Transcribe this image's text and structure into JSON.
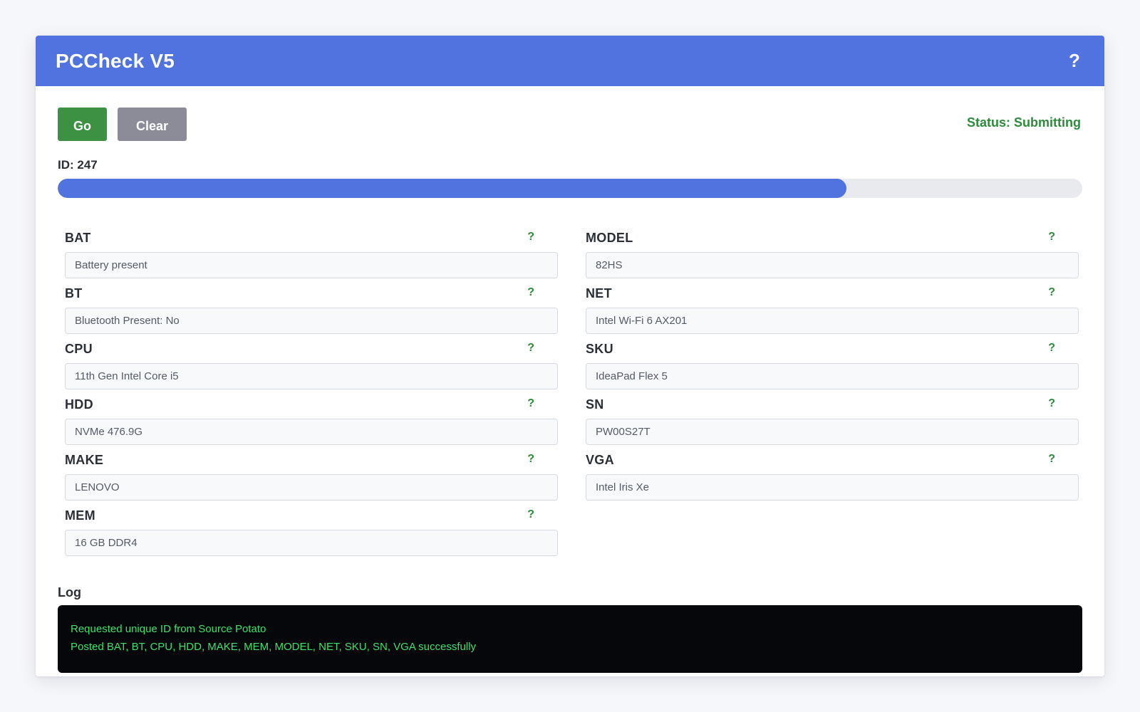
{
  "app": {
    "title": "PCCheck V5",
    "help_label": "?"
  },
  "toolbar": {
    "go_label": "Go",
    "clear_label": "Clear",
    "status": "Status: Submitting"
  },
  "job": {
    "id_label": "ID: 247",
    "progress_percent": 77
  },
  "fields": {
    "left": [
      {
        "key": "BAT",
        "label": "BAT",
        "value": "Battery present",
        "help": "?"
      },
      {
        "key": "BT",
        "label": "BT",
        "value": "Bluetooth Present: No",
        "help": "?"
      },
      {
        "key": "CPU",
        "label": "CPU",
        "value": "11th Gen Intel Core i5",
        "help": "?"
      },
      {
        "key": "HDD",
        "label": "HDD",
        "value": "NVMe 476.9G",
        "help": "?"
      },
      {
        "key": "MAKE",
        "label": "MAKE",
        "value": "LENOVO",
        "help": "?"
      },
      {
        "key": "MEM",
        "label": "MEM",
        "value": "16 GB DDR4",
        "help": "?"
      }
    ],
    "right": [
      {
        "key": "MODEL",
        "label": "MODEL",
        "value": "82HS",
        "help": "?"
      },
      {
        "key": "NET",
        "label": "NET",
        "value": "Intel Wi-Fi 6 AX201",
        "help": "?"
      },
      {
        "key": "SKU",
        "label": "SKU",
        "value": "IdeaPad Flex 5",
        "help": "?"
      },
      {
        "key": "SN",
        "label": "SN",
        "value": "PW00S27T",
        "help": "?"
      },
      {
        "key": "VGA",
        "label": "VGA",
        "value": "Intel Iris Xe",
        "help": "?"
      }
    ]
  },
  "log": {
    "label": "Log",
    "lines": [
      "Requested unique ID from Source Potato",
      "Posted BAT, BT, CPU, HDD, MAKE, MEM, MODEL, NET, SKU, SN, VGA successfully"
    ]
  },
  "colors": {
    "accent": "#5073df",
    "go": "#3d9142",
    "clear": "#8b8c98",
    "status": "#2f8a3c",
    "log_text": "#3ee06a"
  }
}
